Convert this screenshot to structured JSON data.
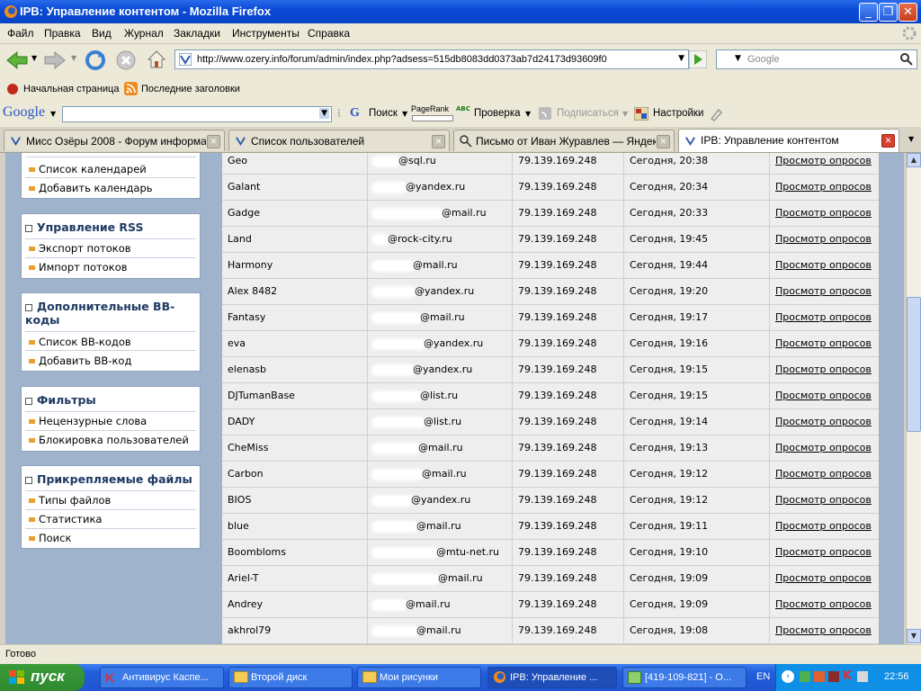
{
  "window": {
    "title": "IPB: Управление контентом - Mozilla Firefox"
  },
  "menu": [
    "Файл",
    "Правка",
    "Вид",
    "Журнал",
    "Закладки",
    "Инструменты",
    "Справка"
  ],
  "nav": {
    "url": "http://www.ozery.info/forum/admin/index.php?adsess=515db8083dd0373ab7d24173d93609f0",
    "search_placeholder": "Google"
  },
  "bookmarks": [
    "Начальная страница",
    "Последние заголовки"
  ],
  "google_bar": {
    "logo": "Google",
    "search": "Поиск",
    "pagerank": "PageRank",
    "check_abbr": "ABC",
    "check": "Проверка",
    "subscribe": "Подписаться",
    "settings": "Настройки"
  },
  "tabs": [
    {
      "label": "Мисс Озёры 2008 - Форум информац...",
      "active": false
    },
    {
      "label": "Список пользователей",
      "active": false
    },
    {
      "label": "Письмо от Иван Журавлев — Яндек...",
      "active": false
    },
    {
      "label": "IPB: Управление контентом",
      "active": true
    }
  ],
  "sidebar": [
    {
      "title": "",
      "items": [
        "Список календарей",
        "Добавить календарь"
      ]
    },
    {
      "title": "Управление RSS",
      "items": [
        "Экспорт потоков",
        "Импорт потоков"
      ]
    },
    {
      "title": "Дополнительные BB-коды",
      "items": [
        "Список BB-кодов",
        "Добавить BB-код"
      ]
    },
    {
      "title": "Фильтры",
      "items": [
        "Нецензурные слова",
        "Блокировка пользователей"
      ]
    },
    {
      "title": "Прикрепляемые файлы",
      "items": [
        "Типы файлов",
        "Статистика",
        "Поиск"
      ]
    }
  ],
  "table": {
    "link_label": "Просмотр опросов",
    "rows": [
      {
        "name": "Geo",
        "email": "@sql.ru",
        "ip": "79.139.169.248",
        "time": "Сегодня, 20:38"
      },
      {
        "name": "Galant",
        "email": "@yandex.ru",
        "ip": "79.139.169.248",
        "time": "Сегодня, 20:34"
      },
      {
        "name": "Gadge",
        "email": "@mail.ru",
        "ip": "79.139.169.248",
        "time": "Сегодня, 20:33"
      },
      {
        "name": "Land",
        "email": "@rock-city.ru",
        "ip": "79.139.169.248",
        "time": "Сегодня, 19:45"
      },
      {
        "name": "Harmony",
        "email": "@mail.ru",
        "ip": "79.139.169.248",
        "time": "Сегодня, 19:44"
      },
      {
        "name": "Alex 8482",
        "email": "@yandex.ru",
        "ip": "79.139.169.248",
        "time": "Сегодня, 19:20"
      },
      {
        "name": "Fantasy",
        "email": "@mail.ru",
        "ip": "79.139.169.248",
        "time": "Сегодня, 19:17"
      },
      {
        "name": "eva",
        "email": "@yandex.ru",
        "ip": "79.139.169.248",
        "time": "Сегодня, 19:16"
      },
      {
        "name": "elenasb",
        "email": "@yandex.ru",
        "ip": "79.139.169.248",
        "time": "Сегодня, 19:15"
      },
      {
        "name": "DJTumanBase",
        "email": "@list.ru",
        "ip": "79.139.169.248",
        "time": "Сегодня, 19:15"
      },
      {
        "name": "DADY",
        "email": "@list.ru",
        "ip": "79.139.169.248",
        "time": "Сегодня, 19:14"
      },
      {
        "name": "CheMiss",
        "email": "@mail.ru",
        "ip": "79.139.169.248",
        "time": "Сегодня, 19:13"
      },
      {
        "name": "Carbon",
        "email": "@mail.ru",
        "ip": "79.139.169.248",
        "time": "Сегодня, 19:12"
      },
      {
        "name": "BIOS",
        "email": "@yandex.ru",
        "ip": "79.139.169.248",
        "time": "Сегодня, 19:12"
      },
      {
        "name": "blue",
        "email": "@mail.ru",
        "ip": "79.139.169.248",
        "time": "Сегодня, 19:11"
      },
      {
        "name": "Boombloms",
        "email": "@mtu-net.ru",
        "ip": "79.139.169.248",
        "time": "Сегодня, 19:10"
      },
      {
        "name": "Ariel-T",
        "email": "@mail.ru",
        "ip": "79.139.169.248",
        "time": "Сегодня, 19:09"
      },
      {
        "name": "Andrey",
        "email": "@mail.ru",
        "ip": "79.139.169.248",
        "time": "Сегодня, 19:09"
      },
      {
        "name": "akhrol79",
        "email": "@mail.ru",
        "ip": "79.139.169.248",
        "time": "Сегодня, 19:08"
      }
    ]
  },
  "status": {
    "text": "Готово"
  },
  "taskbar": {
    "start": "пуск",
    "tasks": [
      {
        "label": "Антивирус Каспе...",
        "active": false
      },
      {
        "label": "Второй диск",
        "active": false
      },
      {
        "label": "Мои рисунки",
        "active": false
      },
      {
        "label": "IPB: Управление ...",
        "active": true
      },
      {
        "label": "[419-109-821] - О...",
        "active": false
      }
    ],
    "lang": "EN",
    "clock": "22:56"
  }
}
